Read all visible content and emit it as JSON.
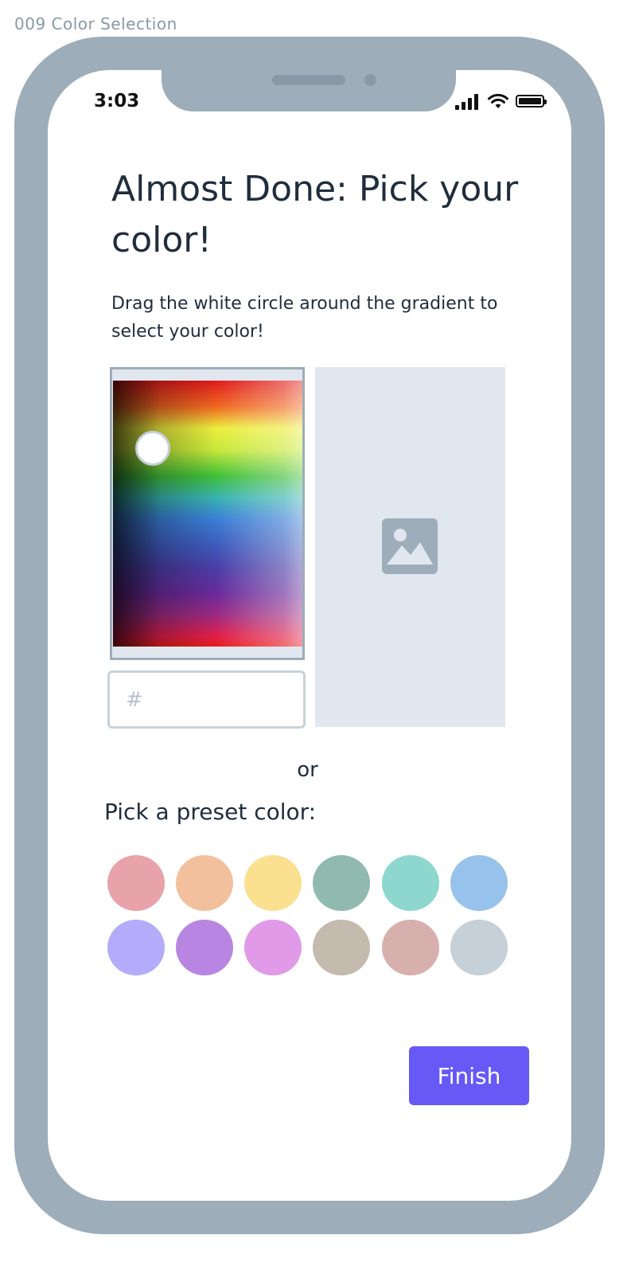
{
  "frame_label": "009 Color Selection",
  "status_bar": {
    "time": "3:03",
    "icons": [
      "signal-icon",
      "wifi-icon",
      "battery-icon"
    ]
  },
  "page": {
    "title": "Almost Done: Pick your color!",
    "subtitle": "Drag the white circle around the gradient to select your color!"
  },
  "color_picker": {
    "hex_placeholder": "#",
    "hex_value": ""
  },
  "preview": {
    "icon": "image-placeholder-icon"
  },
  "divider_text": "or",
  "presets": {
    "label": "Pick a preset color:",
    "colors": [
      "#e8a2aa",
      "#f3c09e",
      "#fbe08f",
      "#90b9b0",
      "#8dd7cf",
      "#97c2eb",
      "#b4abfa",
      "#b886e2",
      "#e09ae7",
      "#c4baad",
      "#d7b0ae",
      "#c5d0d9"
    ]
  },
  "actions": {
    "finish_label": "Finish"
  },
  "theme": {
    "accent": "#6659f6",
    "phone_frame": "#9dadb9",
    "text": "#1f2d3d"
  }
}
